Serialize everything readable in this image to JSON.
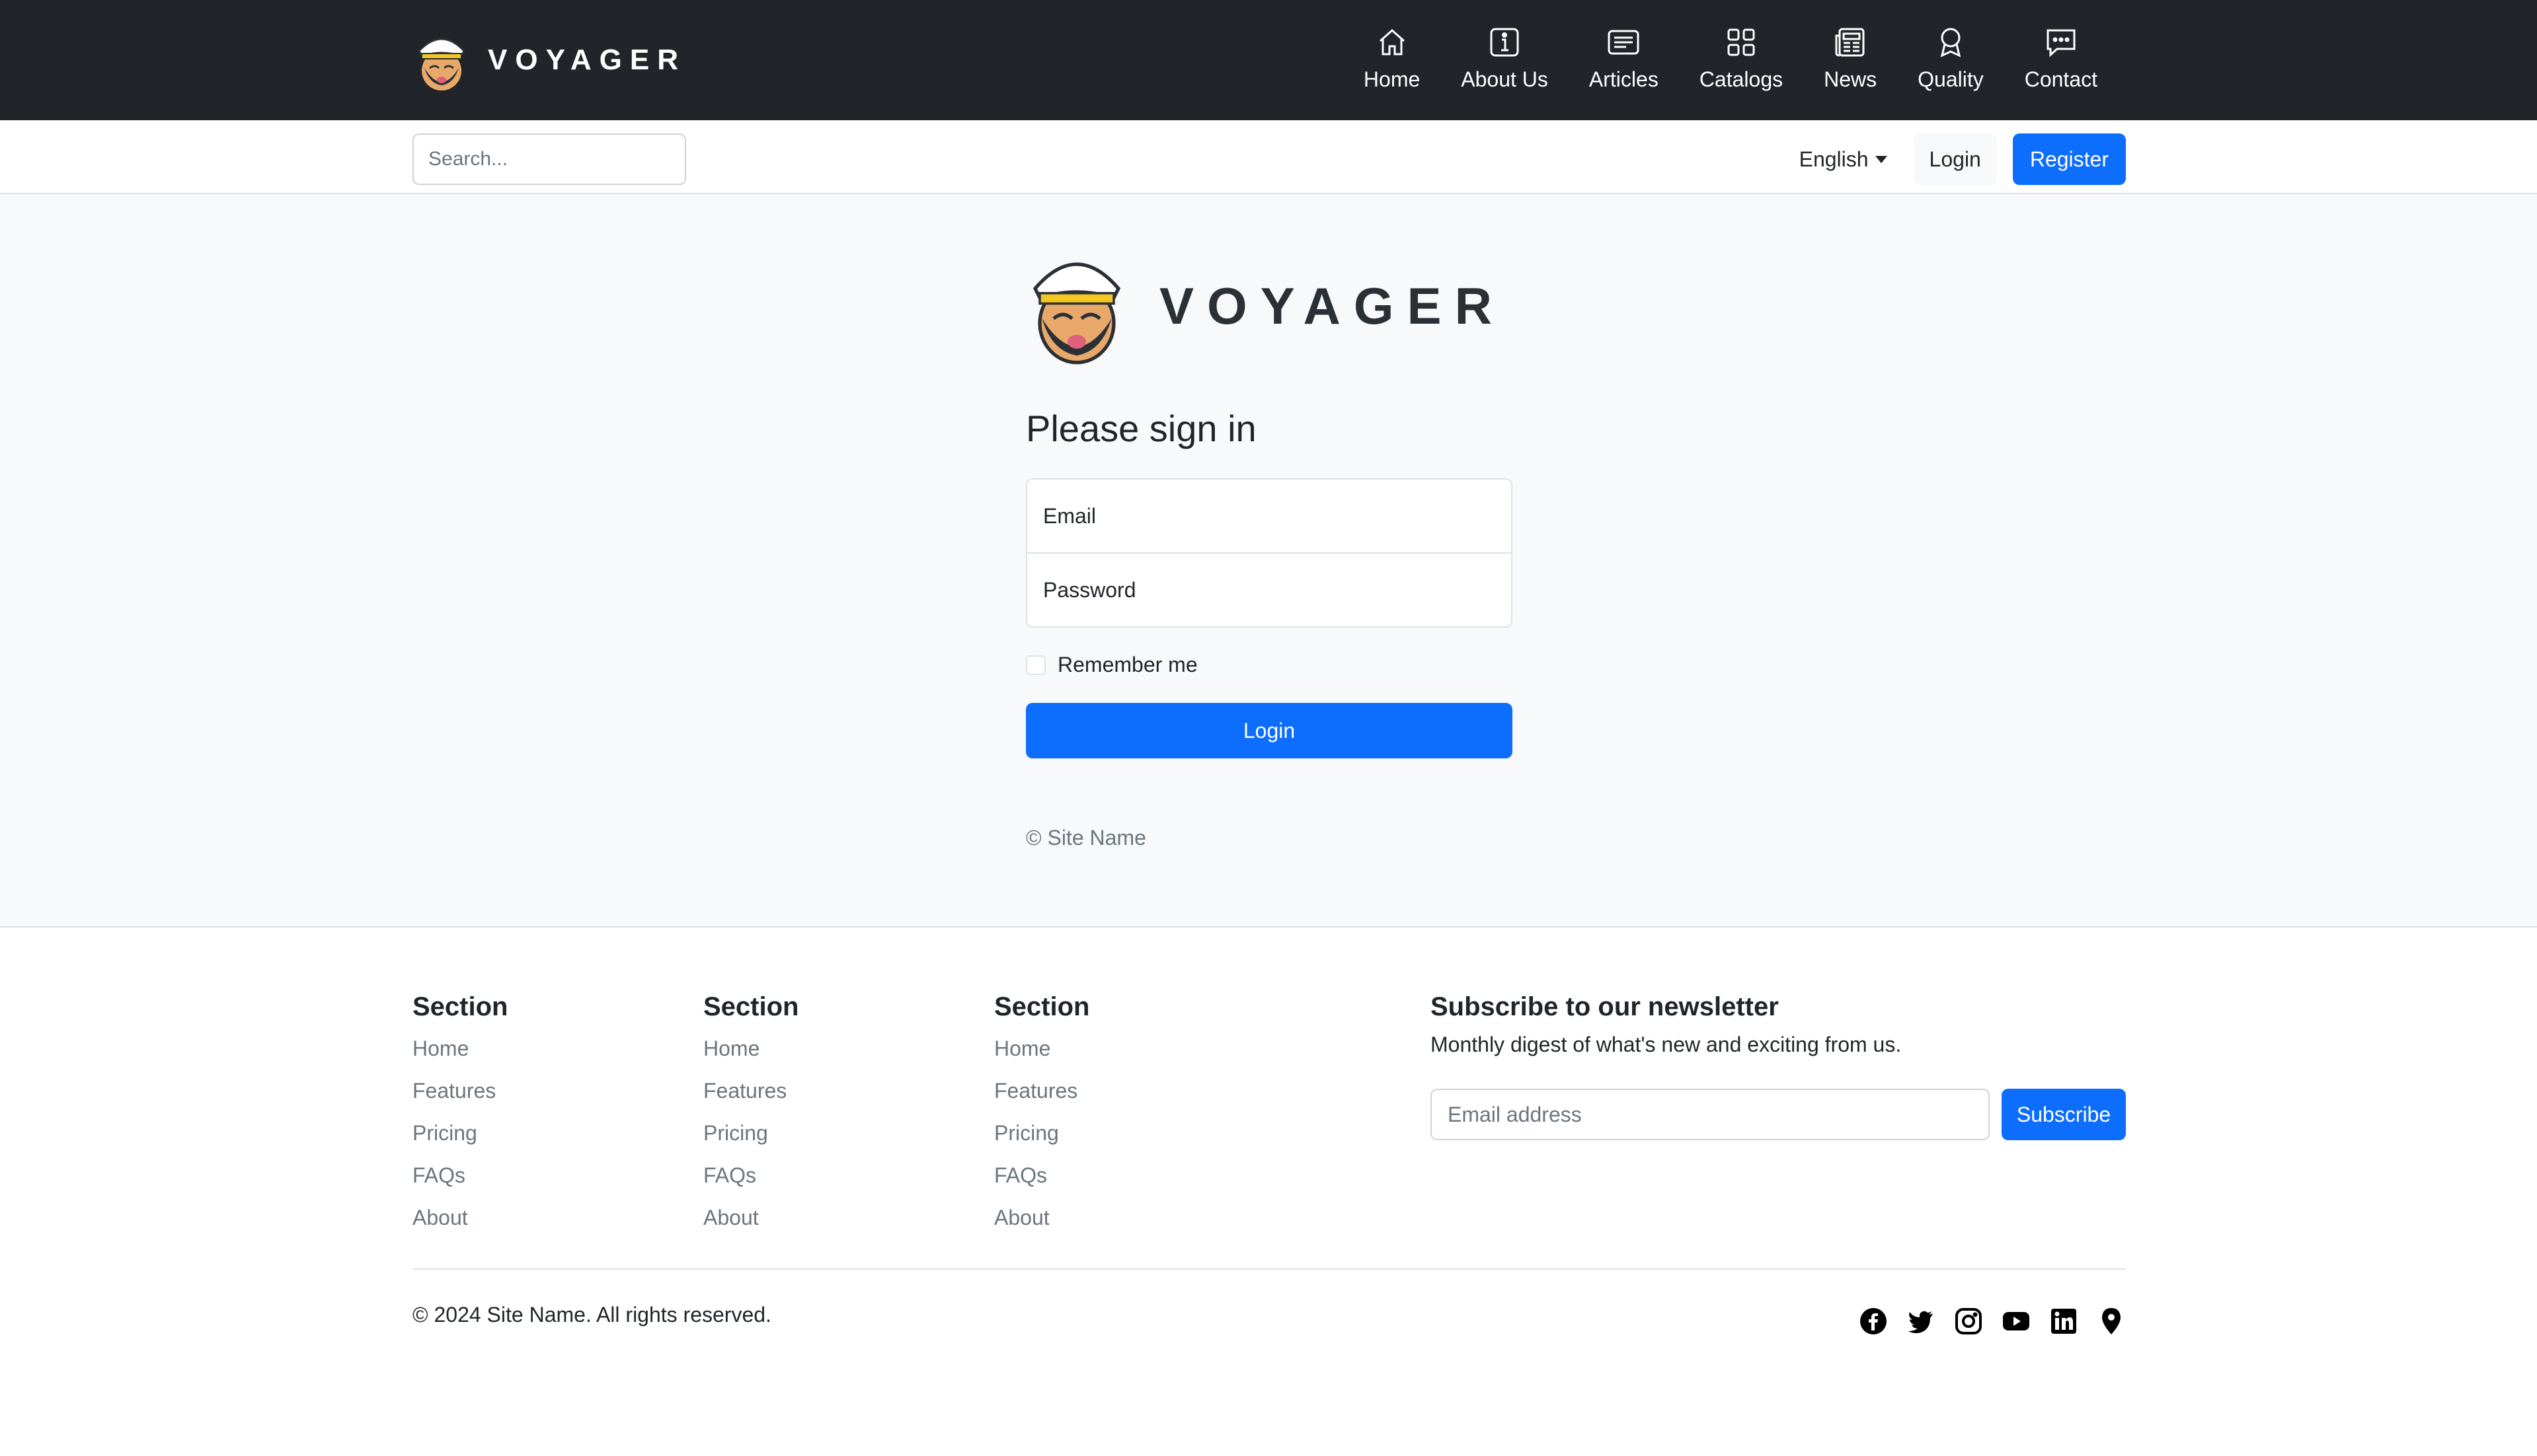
{
  "brand": {
    "name": "VOYAGER"
  },
  "nav": {
    "items": [
      {
        "label": "Home",
        "icon": "home-icon"
      },
      {
        "label": "About Us",
        "icon": "info-icon"
      },
      {
        "label": "Articles",
        "icon": "articles-icon"
      },
      {
        "label": "Catalogs",
        "icon": "grid-icon"
      },
      {
        "label": "News",
        "icon": "newspaper-icon"
      },
      {
        "label": "Quality",
        "icon": "award-icon"
      },
      {
        "label": "Contact",
        "icon": "chat-icon"
      }
    ]
  },
  "subbar": {
    "search_placeholder": "Search...",
    "language": "English",
    "login_label": "Login",
    "register_label": "Register"
  },
  "signin": {
    "logo_text": "VOYAGER",
    "title": "Please sign in",
    "email_placeholder": "Email",
    "password_placeholder": "Password",
    "remember_label": "Remember me",
    "submit_label": "Login",
    "copyright": "© Site Name"
  },
  "footer": {
    "columns": [
      {
        "heading": "Section",
        "links": [
          "Home",
          "Features",
          "Pricing",
          "FAQs",
          "About"
        ]
      },
      {
        "heading": "Section",
        "links": [
          "Home",
          "Features",
          "Pricing",
          "FAQs",
          "About"
        ]
      },
      {
        "heading": "Section",
        "links": [
          "Home",
          "Features",
          "Pricing",
          "FAQs",
          "About"
        ]
      }
    ],
    "newsletter": {
      "heading": "Subscribe to our newsletter",
      "text": "Monthly digest of what's new and exciting from us.",
      "placeholder": "Email address",
      "button_label": "Subscribe"
    },
    "copyright": "© 2024 Site Name. All rights reserved.",
    "social_icons": [
      "facebook-icon",
      "twitter-icon",
      "instagram-icon",
      "youtube-icon",
      "linkedin-icon",
      "map-pin-icon"
    ]
  },
  "colors": {
    "navbar_bg": "#212529",
    "primary": "#0d6efd",
    "main_bg": "#f8f9fa",
    "muted_text": "#6c757d"
  }
}
